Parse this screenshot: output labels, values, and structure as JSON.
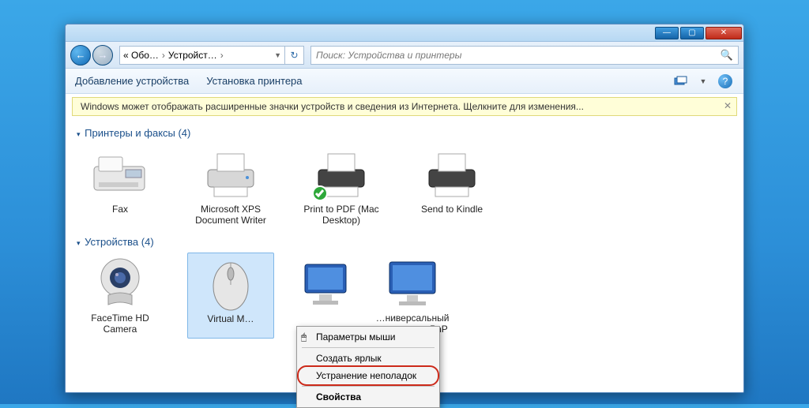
{
  "titlebar": {
    "min": "—",
    "max": "▢",
    "close": "✕"
  },
  "nav": {
    "back_glyph": "←",
    "fwd_glyph": "→",
    "crumb1": "« Обо…",
    "crumb2": "Устройст…",
    "refresh_glyph": "↻"
  },
  "search": {
    "placeholder": "Поиск: Устройства и принтеры",
    "mag_glyph": "🔍"
  },
  "toolbar": {
    "add": "Добавление устройства",
    "printer": "Установка принтера",
    "help_glyph": "?"
  },
  "infobar": {
    "text": "Windows может отображать расширенные значки устройств и сведения из Интернета.   Щелкните для изменения...",
    "close_glyph": "✕"
  },
  "groups": {
    "printers": {
      "header": "Принтеры и факсы (4)",
      "items": [
        {
          "name": "Fax"
        },
        {
          "name": "Microsoft XPS Document Writer"
        },
        {
          "name": "Print to PDF (Mac Desktop)"
        },
        {
          "name": "Send to Kindle"
        }
      ]
    },
    "devices": {
      "header": "Устройства (4)",
      "items": [
        {
          "name": "FaceTime HD Camera"
        },
        {
          "name": "Virtual M…"
        },
        {
          "name": "…ниверсальный монитор не PnP"
        }
      ]
    }
  },
  "context_menu": {
    "items": [
      {
        "label": "Параметры мыши",
        "icon": "🖱"
      },
      {
        "label": "Создать ярлык"
      },
      {
        "label": "Устранение неполадок",
        "highlight": true
      },
      {
        "label": "Свойства",
        "bold": true
      }
    ]
  }
}
